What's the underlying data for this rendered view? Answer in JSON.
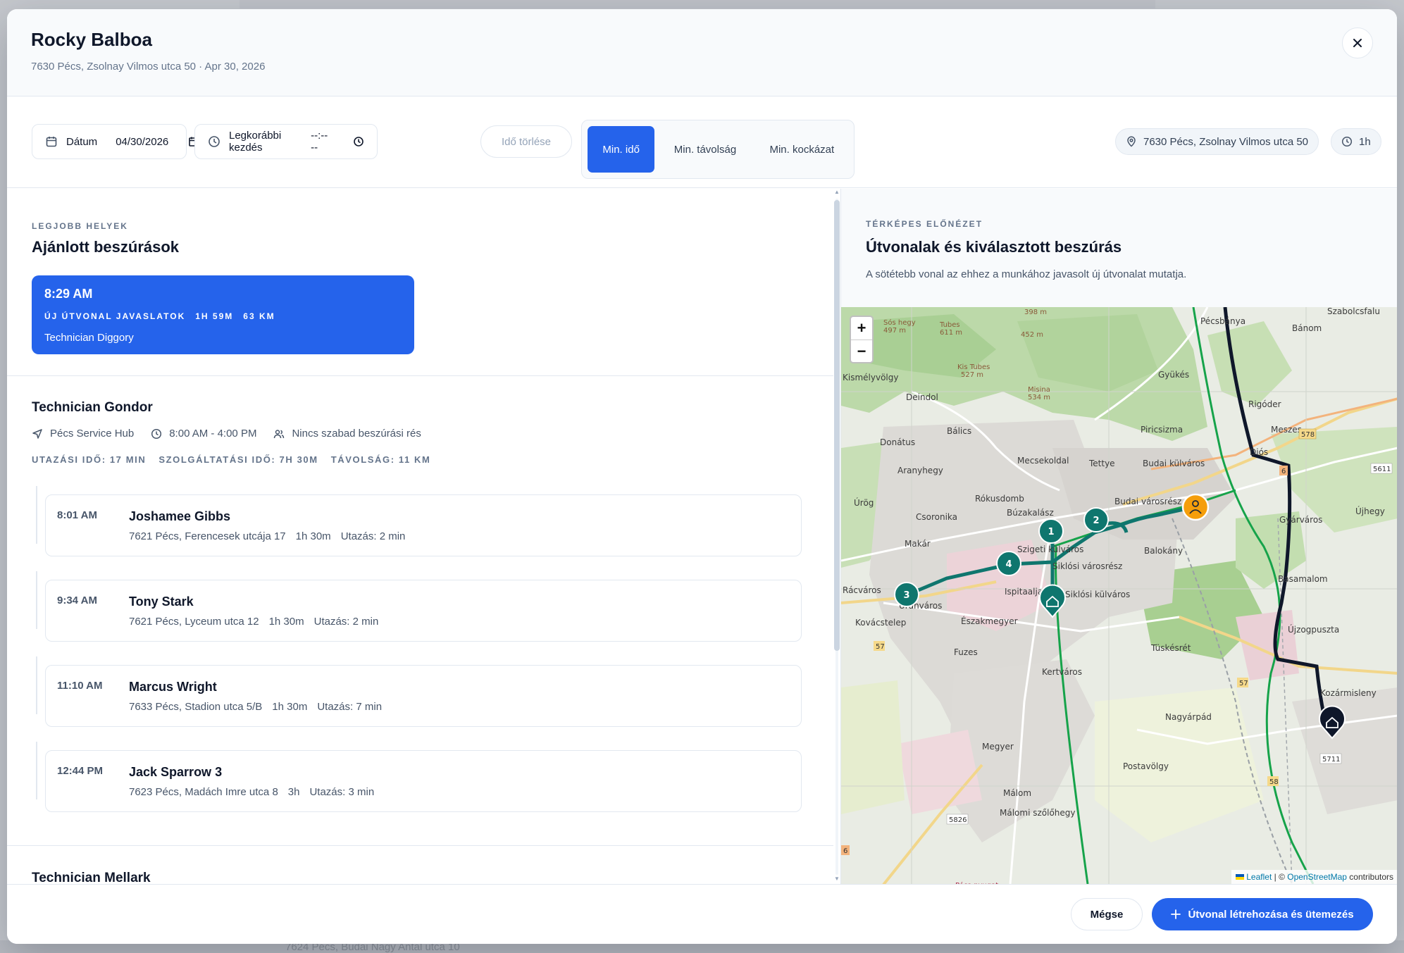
{
  "modal": {
    "title": "Rocky Balboa",
    "subtitle": "7630 Pécs, Zsolnay Vilmos utca 50 · Apr 30, 2026",
    "close_label": "×"
  },
  "toolbar": {
    "date_label": "Dátum",
    "date_value": "04/30/2026",
    "start_label": "Legkorábbi kezdés",
    "start_value": "--:-- --",
    "clear_label": "Idő törlése",
    "modes": [
      {
        "label": "Min. idő",
        "active": true
      },
      {
        "label": "Min. távolság",
        "active": false
      },
      {
        "label": "Min. kockázat",
        "active": false
      }
    ],
    "location_chip": "7630 Pécs, Zsolnay Vilmos utca 50",
    "duration_chip": "1h"
  },
  "recommendations": {
    "eyebrow": "Legjobb helyek",
    "title": "Ajánlott beszúrások",
    "card": {
      "time": "8:29 AM",
      "tag": "Új útvonal javaslatok",
      "duration": "1h 59m",
      "distance": "63 km",
      "technician": "Technician Diggory"
    }
  },
  "technicians": [
    {
      "name": "Technician Gondor",
      "hub": "Pécs Service Hub",
      "hours": "8:00 AM - 4:00 PM",
      "gap": "Nincs szabad beszúrási rés",
      "stats": [
        "Utazási idő: 17 min",
        "Szolgáltatási idő: 7h 30m",
        "Távolság: 11 km"
      ],
      "jobs": [
        {
          "time": "8:01 AM",
          "name": "Joshamee Gibbs",
          "address": "7621 Pécs, Ferencesek utcája 17",
          "duration": "1h 30m",
          "travel": "Utazás: 2 min"
        },
        {
          "time": "9:34 AM",
          "name": "Tony Stark",
          "address": "7621 Pécs, Lyceum utca 12",
          "duration": "1h 30m",
          "travel": "Utazás: 2 min"
        },
        {
          "time": "11:10 AM",
          "name": "Marcus Wright",
          "address": "7633 Pécs, Stadion utca 5/B",
          "duration": "1h 30m",
          "travel": "Utazás: 7 min"
        },
        {
          "time": "12:44 PM",
          "name": "Jack Sparrow 3",
          "address": "7623 Pécs, Madách Imre utca 8",
          "duration": "3h",
          "travel": "Utazás: 3 min"
        }
      ]
    },
    {
      "name": "Technician Mellark"
    }
  ],
  "map_panel": {
    "eyebrow": "Térképes előnézet",
    "title": "Útvonalak és kiválasztott beszúrás",
    "description": "A sötétebb vonal az ehhez a munkához javasolt új útvonalat mutatja.",
    "zoom_in": "+",
    "zoom_out": "−",
    "attribution_leaflet": "Leaflet",
    "attribution_sep": " | © ",
    "attribution_osm": "OpenStreetMap",
    "attribution_tail": " contributors",
    "stop_labels": [
      "1",
      "2",
      "3",
      "4"
    ],
    "place_names": [
      "Pécsbánya",
      "Bánom",
      "Szabolcsfalu",
      "Kismélyvölgy",
      "Deindol",
      "Gyükés",
      "Rigóder",
      "Bálics",
      "Piricsizma",
      "Meszes",
      "Donátus",
      "Diós",
      "Aranyhegy",
      "Mecsekoldal",
      "Tettye",
      "Budai külváros",
      "Úrög",
      "Rókusdomb",
      "Budai városrész",
      "Gyárváros",
      "Újhegy",
      "Csoronika",
      "Búzakalász",
      "Makár",
      "Balokány",
      "Szigeti külváros",
      "Siklósi városrész",
      "Basamalom",
      "Rácváros",
      "Ispitaalja",
      "Siklósi külváros",
      "Uránváros",
      "Kovácstelep",
      "Északmegyer",
      "Újzogpuszta",
      "Tüskésrét",
      "Fuzes",
      "Kertváros",
      "Kozármisleny",
      "Nagyárpád",
      "Megyer",
      "Postavölgy",
      "Málom",
      "Málomi szőlőhegy",
      "Pécs-nyugat",
      "Sós hegy",
      "Tubes",
      "Kis Tubes",
      "Misina",
      "Ispitaalja"
    ],
    "road_numbers": [
      "578",
      "5611",
      "6",
      "57",
      "57",
      "5711",
      "58",
      "5826",
      "6"
    ],
    "peak_labels": [
      "497 m",
      "611 m",
      "398 m",
      "452 m",
      "527 m",
      "534 m"
    ],
    "colors": {
      "suggested_route": "#0f172a",
      "existing_route": "#16a34a",
      "stop_marker": "#0f766e",
      "customer_marker": "#f59e0b"
    }
  },
  "footer": {
    "cancel_label": "Mégse",
    "primary_label": "Útvonal létrehozása és ütemezés"
  },
  "backdrop": {
    "peek_text": "7624 Pécs, Budai Nagy Antal utca 10"
  }
}
